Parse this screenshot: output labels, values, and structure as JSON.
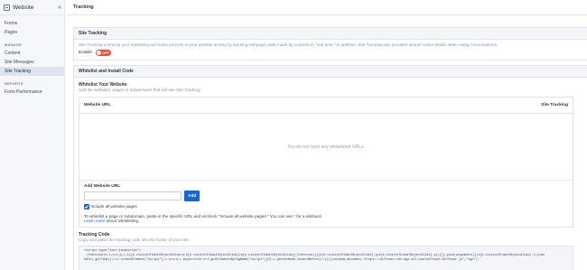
{
  "sidebar": {
    "title": "Website",
    "items_top": [
      "Forms",
      "Pages"
    ],
    "section_manage": "MANAGE",
    "items_manage": [
      "Content",
      "Site Messages",
      "Site Tracking"
    ],
    "active": "Site Tracking",
    "section_reports": "REPORTS",
    "items_reports": [
      "Form Performance"
    ]
  },
  "topbar": {
    "title": "Tracking"
  },
  "site_tracking": {
    "heading": "Site Tracking",
    "description": "Site Tracking connects your marketing and sales process to your website activity by tracking webpage visits made by contacts in \"real-time.\" In addition, Site Tracking also provides deeper visitor details when using Conversations.",
    "enable_label": "Enable",
    "toggle_text": "OFF"
  },
  "whitelist": {
    "heading": "Whitelist and Install Code",
    "sub_heading": "Whitelist Your Website",
    "sub_desc": "Add the websites, pages or subdomains that will use Site Tracking.",
    "col_url": "Website URL",
    "col_tracking": "Site Tracking",
    "empty_text": "You do not have any whitelisted URLs.",
    "add_label": "Add Website URL",
    "input_value": "",
    "add_button": "Add",
    "checkbox_label": "Include all website pages",
    "help_text": "To whitelist a page or subdomain, paste in the specific URL and uncheck \"Include all website pages.\" You can use * for a wildcard.",
    "learn_more": "Learn more",
    "learn_more_suffix": " about whitelisting."
  },
  "tracking_code": {
    "heading": "Tracking Code",
    "desc": "Copy and paste the tracking code into the footer of your site.",
    "line1": "<script type=\"text/javascript\">",
    "line2": "(function(e,t,o,n,p,r,i){e.visitorGlobalObjectAlias=n;e[e.visitorGlobalObjectAlias]=e[e.visitorGlobalObjectAlias]||function(){(e[e.visitorGlobalObjectAlias].q=e[e.visitorGlobalObjectAlias].q||[]).push(arguments)};e[e.visitorGlobalObjectAlias].l=(new",
    "line3": "Date).getTime();r=t.createElement(\"script\");r.src=o;r.async=true;i=t.getElementsByTagName(\"script\")[0];i.parentNode.insertBefore(r,i)})(window,document,\"https://diffuser-cdn.app-us1.com/diffuser/diffuser.js\",\"vgo\");"
  }
}
